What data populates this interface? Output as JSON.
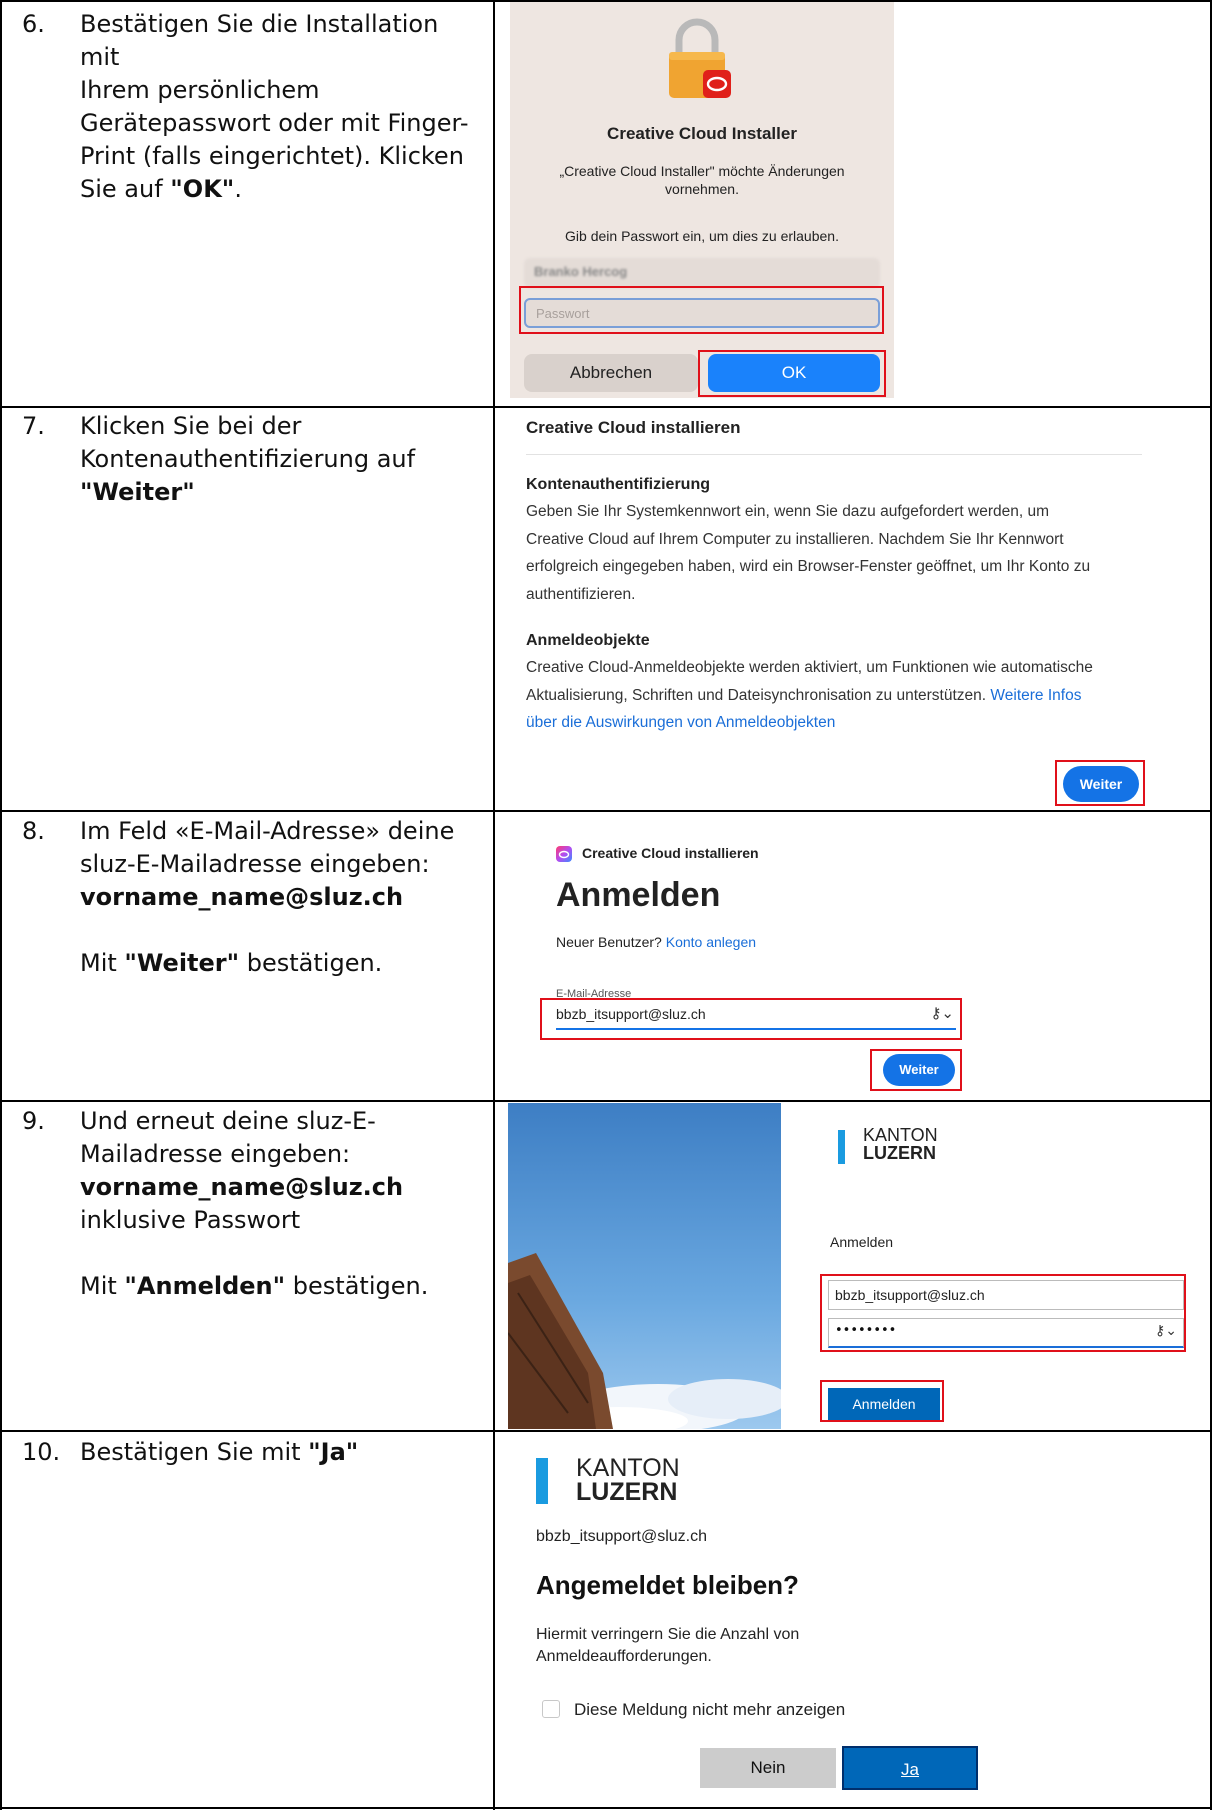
{
  "steps": [
    {
      "num": "6.",
      "lines": [
        "Bestätigen Sie die Installation mit",
        "Ihrem persönlichem",
        "Gerätepasswort oder mit Finger-",
        "Print (falls eingerichtet). Klicken"
      ],
      "last_prefix": "Sie auf ",
      "last_bold": "\"OK\"",
      "last_suffix": "."
    },
    {
      "num": "7.",
      "lines": [
        "Klicken Sie bei der",
        "Kontenauthentifizierung auf"
      ],
      "bold": "\"Weiter\""
    },
    {
      "num": "8.",
      "lines": [
        "Im Feld «E-Mail-Adresse» deine",
        "sluz-E-Mailadresse eingeben:"
      ],
      "bold": "vorname_name@sluz.ch",
      "confirm_prefix": "Mit ",
      "confirm_bold": "\"Weiter\"",
      "confirm_suffix": " bestätigen."
    },
    {
      "num": "9.",
      "lines": [
        "Und erneut deine sluz-E-",
        "Mailadresse eingeben:"
      ],
      "bold": "vorname_name@sluz.ch",
      "extra": "inklusive Passwort",
      "confirm_prefix": "Mit ",
      "confirm_bold": "\"Anmelden\"",
      "confirm_suffix": " bestätigen."
    },
    {
      "num": "10.",
      "prefix": "Bestätigen Sie mit ",
      "bold": "\"Ja\""
    }
  ],
  "mac_dialog": {
    "title": "Creative Cloud Installer",
    "message_line1": "„Creative Cloud Installer\" möchte Änderungen",
    "message_line2": "vornehmen.",
    "prompt": "Gib dein Passwort ein, um dies zu erlauben.",
    "username": "Branko Hercog",
    "password_placeholder": "Passwort",
    "cancel": "Abbrechen",
    "ok": "OK"
  },
  "adobe_auth": {
    "title": "Creative Cloud installieren",
    "section1_heading": "Kontenauthentifizierung",
    "section1_lines": [
      "Geben Sie Ihr Systemkennwort ein, wenn Sie dazu aufgefordert werden, um",
      "Creative Cloud auf Ihrem Computer zu installieren. Nachdem Sie Ihr Kennwort",
      "erfolgreich eingegeben haben, wird ein Browser-Fenster geöffnet, um Ihr Konto zu",
      "authentifizieren."
    ],
    "section2_heading": "Anmeldeobjekte",
    "section2_line1": "Creative Cloud-Anmeldeobjekte werden aktiviert, um Funktionen wie automatische",
    "section2_line2": "Aktualisierung, Schriften und Dateisynchronisation zu unterstützen. ",
    "section2_link1": "Weitere Infos",
    "section2_link2": "über die Auswirkungen von Anmeldeobjekten",
    "button": "Weiter"
  },
  "adobe_signin": {
    "app_name": "Creative Cloud installieren",
    "heading": "Anmelden",
    "new_user": "Neuer Benutzer? ",
    "create_account": "Konto anlegen",
    "email_label": "E-Mail-Adresse",
    "email_value": "bbzb_itsupport@sluz.ch",
    "button": "Weiter"
  },
  "kanton_signin": {
    "brand_line1": "KANTON",
    "brand_line2": "LUZERN",
    "heading": "Anmelden",
    "email_value": "bbzb_itsupport@sluz.ch",
    "password_value": "••••••••",
    "button": "Anmelden"
  },
  "stay_signed_in": {
    "brand_line1": "KANTON",
    "brand_line2": "LUZERN",
    "account": "bbzb_itsupport@sluz.ch",
    "heading": "Angemeldet bleiben?",
    "text_line1": "Hiermit verringern Sie die Anzahl von",
    "text_line2": "Anmeldeaufforderungen.",
    "checkbox_label": "Diese Meldung nicht mehr anzeigen",
    "no": "Nein",
    "yes": "Ja"
  }
}
